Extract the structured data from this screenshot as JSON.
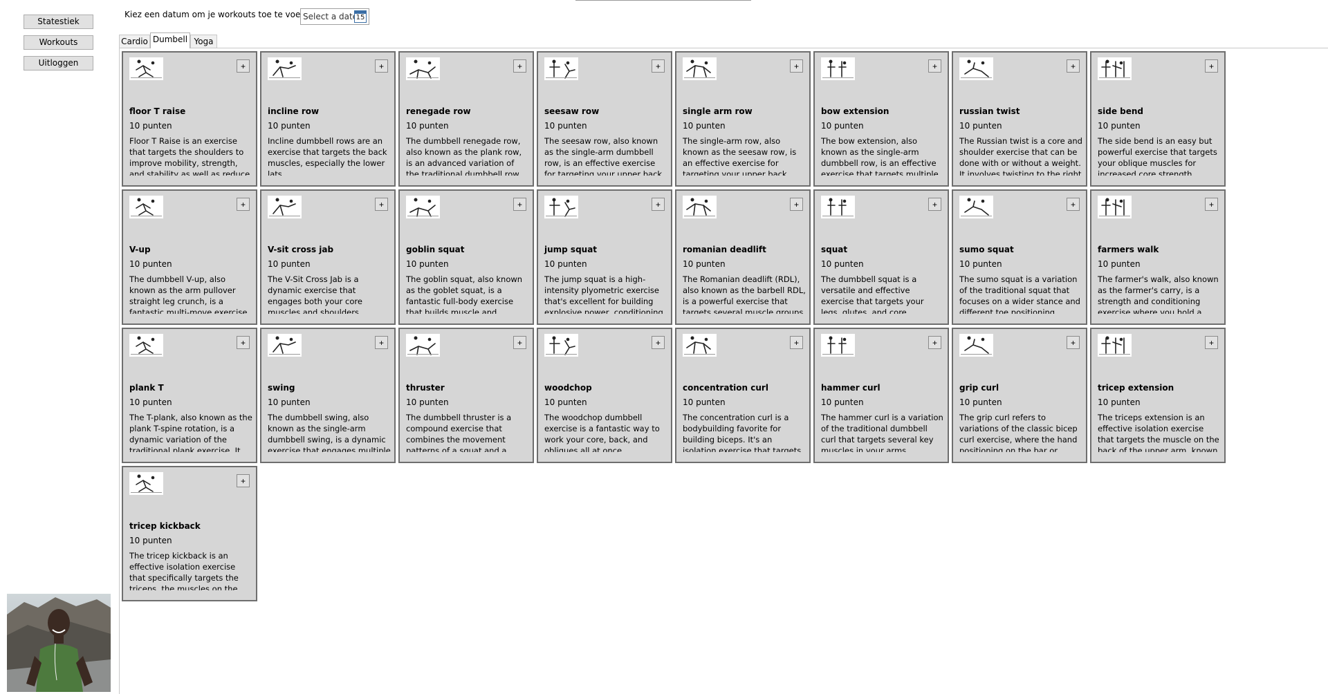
{
  "nav": {
    "buttons": [
      "Statestiek",
      "Workouts",
      "Uitloggen"
    ]
  },
  "date_row": {
    "label": "Kiez een datum om je workouts toe te voegen",
    "placeholder": "Select a date",
    "calendar_day": "15"
  },
  "tabs": [
    "Cardio",
    "Dumbell",
    "Yoga"
  ],
  "active_tab": "Dumbell",
  "add_label": "+",
  "exercises": [
    {
      "title": "floor T raise",
      "points": "10 punten",
      "desc": "Floor T Raise is an exercise that targets the shoulders to improve mobility, strength, and stability as well as reduce the risk of"
    },
    {
      "title": "incline row",
      "points": "10 punten",
      "desc": "Incline dumbbell rows are an exercise that targets the back muscles, especially the lower lats."
    },
    {
      "title": "renegade row",
      "points": "10 punten",
      "desc": "The dumbbell renegade row, also known as the plank row, is an advanced variation of the traditional dumbbell row. It's a"
    },
    {
      "title": "seesaw row",
      "points": "10 punten",
      "desc": "The seesaw row, also known as the single-arm dumbbell row, is an effective exercise for targeting your upper back, lats"
    },
    {
      "title": "single arm row",
      "points": "10 punten",
      "desc": "The single-arm row, also known as the seesaw row, is an effective exercise for targeting your upper back, lats, and rhomboids."
    },
    {
      "title": "bow extension",
      "points": "10 punten",
      "desc": "The bow extension, also known as the single-arm dumbbell row, is an effective exercise that targets multiple muscle groups"
    },
    {
      "title": "russian twist",
      "points": "10 punten",
      "desc": "The Russian twist is a core and shoulder exercise that can be done with or without a weight. It involves twisting to the right and"
    },
    {
      "title": "side bend",
      "points": "10 punten",
      "desc": "The side bend is an easy but powerful exercise that targets your oblique muscles for increased core strength."
    },
    {
      "title": "V-up",
      "points": "10 punten",
      "desc": "The dumbbell V-up, also known as the arm pullover straight leg crunch, is a fantastic multi-move exercise that targets your abs."
    },
    {
      "title": "V-sit cross jab",
      "points": "10 punten",
      "desc": "The V-Sit Cross Jab is a dynamic exercise that engages both your core muscles and shoulders."
    },
    {
      "title": "goblin squat",
      "points": "10 punten",
      "desc": "The goblin squat, also known as the goblet squat, is a fantastic full-body exercise that builds muscle and develops"
    },
    {
      "title": "jump squat",
      "points": "10 punten",
      "desc": "The jump squat is a high-intensity plyometric exercise that's excellent for building explosive power, conditioning"
    },
    {
      "title": "romanian deadlift",
      "points": "10 punten",
      "desc": "The Romanian deadlift (RDL), also known as the barbell RDL, is a powerful exercise that targets several muscle groups"
    },
    {
      "title": "squat",
      "points": "10 punten",
      "desc": "The dumbbell squat is a versatile and effective exercise that targets your legs, glutes, and core."
    },
    {
      "title": "sumo squat",
      "points": "10 punten",
      "desc": "The sumo squat is a variation of the traditional squat that focuses on a wider stance and different toe positioning."
    },
    {
      "title": "farmers walk",
      "points": "10 punten",
      "desc": "The farmer's walk, also known as the farmer's carry, is a strength and conditioning exercise where you hold a heavy load in each"
    },
    {
      "title": "plank T",
      "points": "10 punten",
      "desc": "The T-plank, also known as the plank T-spine rotation, is a dynamic variation of the traditional plank exercise. It"
    },
    {
      "title": "swing",
      "points": "10 punten",
      "desc": "The dumbbell swing, also known as the single-arm dumbbell swing, is a dynamic exercise that engages multiple muscle"
    },
    {
      "title": "thruster",
      "points": "10 punten",
      "desc": "The dumbbell thruster is a compound exercise that combines the movement patterns of a squat and a"
    },
    {
      "title": "woodchop",
      "points": "10 punten",
      "desc": "The woodchop dumbbell exercise is a fantastic way to work your core, back, and obliques all at once."
    },
    {
      "title": "concentration curl",
      "points": "10 punten",
      "desc": "The concentration curl is a bodybuilding favorite for building biceps. It's an isolation exercise that targets the short"
    },
    {
      "title": "hammer curl",
      "points": "10 punten",
      "desc": "The hammer curl is a variation of the traditional dumbbell curl that targets several key muscles in your arms."
    },
    {
      "title": "grip curl",
      "points": "10 punten",
      "desc": "The grip curl refers to variations of the classic bicep curl exercise, where the hand positioning on the bar or dumbbell changes."
    },
    {
      "title": "tricep extension",
      "points": "10 punten",
      "desc": "The triceps extension is an effective isolation exercise that targets the muscle on the back of the upper arm, known as the"
    },
    {
      "title": "tricep kickback",
      "points": "10 punten",
      "desc": "The tricep kickback is an effective isolation exercise that specifically targets the triceps, the muscles on the back of your"
    }
  ]
}
